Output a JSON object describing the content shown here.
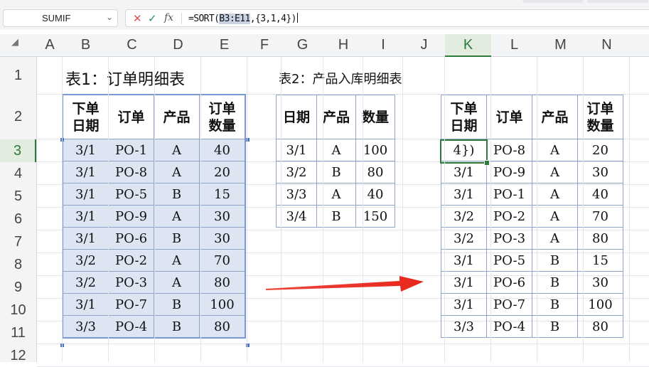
{
  "name_box": {
    "value": "SUMIF"
  },
  "formula_bar": {
    "cancel_icon": "close-icon",
    "enter_icon": "check-icon",
    "fx_label": "fx",
    "formula_prefix": "=SORT(",
    "formula_range": "B3:E11",
    "formula_suffix": ",{3,1,4})"
  },
  "columns": [
    "A",
    "B",
    "C",
    "D",
    "E",
    "F",
    "G",
    "H",
    "I",
    "J",
    "K",
    "L",
    "M",
    "N"
  ],
  "rows": [
    "1",
    "2",
    "3",
    "4",
    "5",
    "6",
    "7",
    "8",
    "9",
    "10",
    "11",
    "12"
  ],
  "selected_column": "K",
  "selected_row": "3",
  "table1": {
    "title": "表1：订单明细表",
    "headers": [
      [
        "下单",
        "日期"
      ],
      [
        "订单"
      ],
      [
        "产品"
      ],
      [
        "订单",
        "数量"
      ]
    ],
    "rows": [
      [
        "3/1",
        "PO-1",
        "A",
        "40"
      ],
      [
        "3/1",
        "PO-8",
        "A",
        "20"
      ],
      [
        "3/1",
        "PO-5",
        "B",
        "15"
      ],
      [
        "3/1",
        "PO-9",
        "A",
        "30"
      ],
      [
        "3/1",
        "PO-6",
        "B",
        "30"
      ],
      [
        "3/2",
        "PO-2",
        "A",
        "70"
      ],
      [
        "3/2",
        "PO-3",
        "A",
        "80"
      ],
      [
        "3/1",
        "PO-7",
        "B",
        "100"
      ],
      [
        "3/3",
        "PO-4",
        "B",
        "80"
      ]
    ]
  },
  "table2": {
    "title": "表2：产品入库明细表",
    "headers": [
      [
        "日期"
      ],
      [
        "产品"
      ],
      [
        "数量"
      ]
    ],
    "rows": [
      [
        "3/1",
        "A",
        "100"
      ],
      [
        "3/2",
        "B",
        "80"
      ],
      [
        "3/3",
        "A",
        "40"
      ],
      [
        "3/4",
        "B",
        "150"
      ]
    ]
  },
  "table3": {
    "headers": [
      [
        "下单",
        "日期"
      ],
      [
        "订单"
      ],
      [
        "产品"
      ],
      [
        "订单",
        "数量"
      ]
    ],
    "editing_cell": "4})",
    "rows": [
      [
        "4})",
        "PO-8",
        "A",
        "20"
      ],
      [
        "3/1",
        "PO-9",
        "A",
        "30"
      ],
      [
        "3/1",
        "PO-1",
        "A",
        "40"
      ],
      [
        "3/2",
        "PO-2",
        "A",
        "70"
      ],
      [
        "3/2",
        "PO-3",
        "A",
        "80"
      ],
      [
        "3/1",
        "PO-5",
        "B",
        "15"
      ],
      [
        "3/1",
        "PO-6",
        "B",
        "30"
      ],
      [
        "3/1",
        "PO-7",
        "B",
        "100"
      ],
      [
        "3/3",
        "PO-4",
        "B",
        "80"
      ]
    ]
  },
  "colors": {
    "accent_green": "#2d7a3a",
    "range_highlight": "#dde4f2",
    "table_border": "#8ea4c9",
    "arrow_red": "#e8261b"
  }
}
